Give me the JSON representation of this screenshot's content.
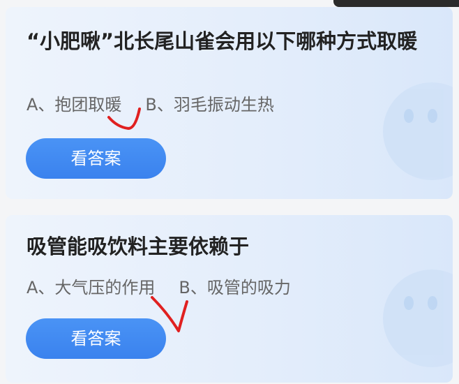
{
  "questions": [
    {
      "text": "“小肥啾”北长尾山雀会用以下哪种方式取暖",
      "option_a": "A、抱团取暖",
      "option_b": "B、羽毛振动生热",
      "button_label": "看答案"
    },
    {
      "text": "吸管能吸饮料主要依赖于",
      "option_a": "A、大气压的作用",
      "option_b": "B、吸管的吸力",
      "button_label": "看答案"
    }
  ],
  "colors": {
    "accent": "#3a86f0",
    "checkmark": "#e02020",
    "card_bg": "#e6effb"
  },
  "icons": {
    "checkmark": "handwritten-red-checkmark",
    "mascot": "mascot-ghost-icon"
  }
}
